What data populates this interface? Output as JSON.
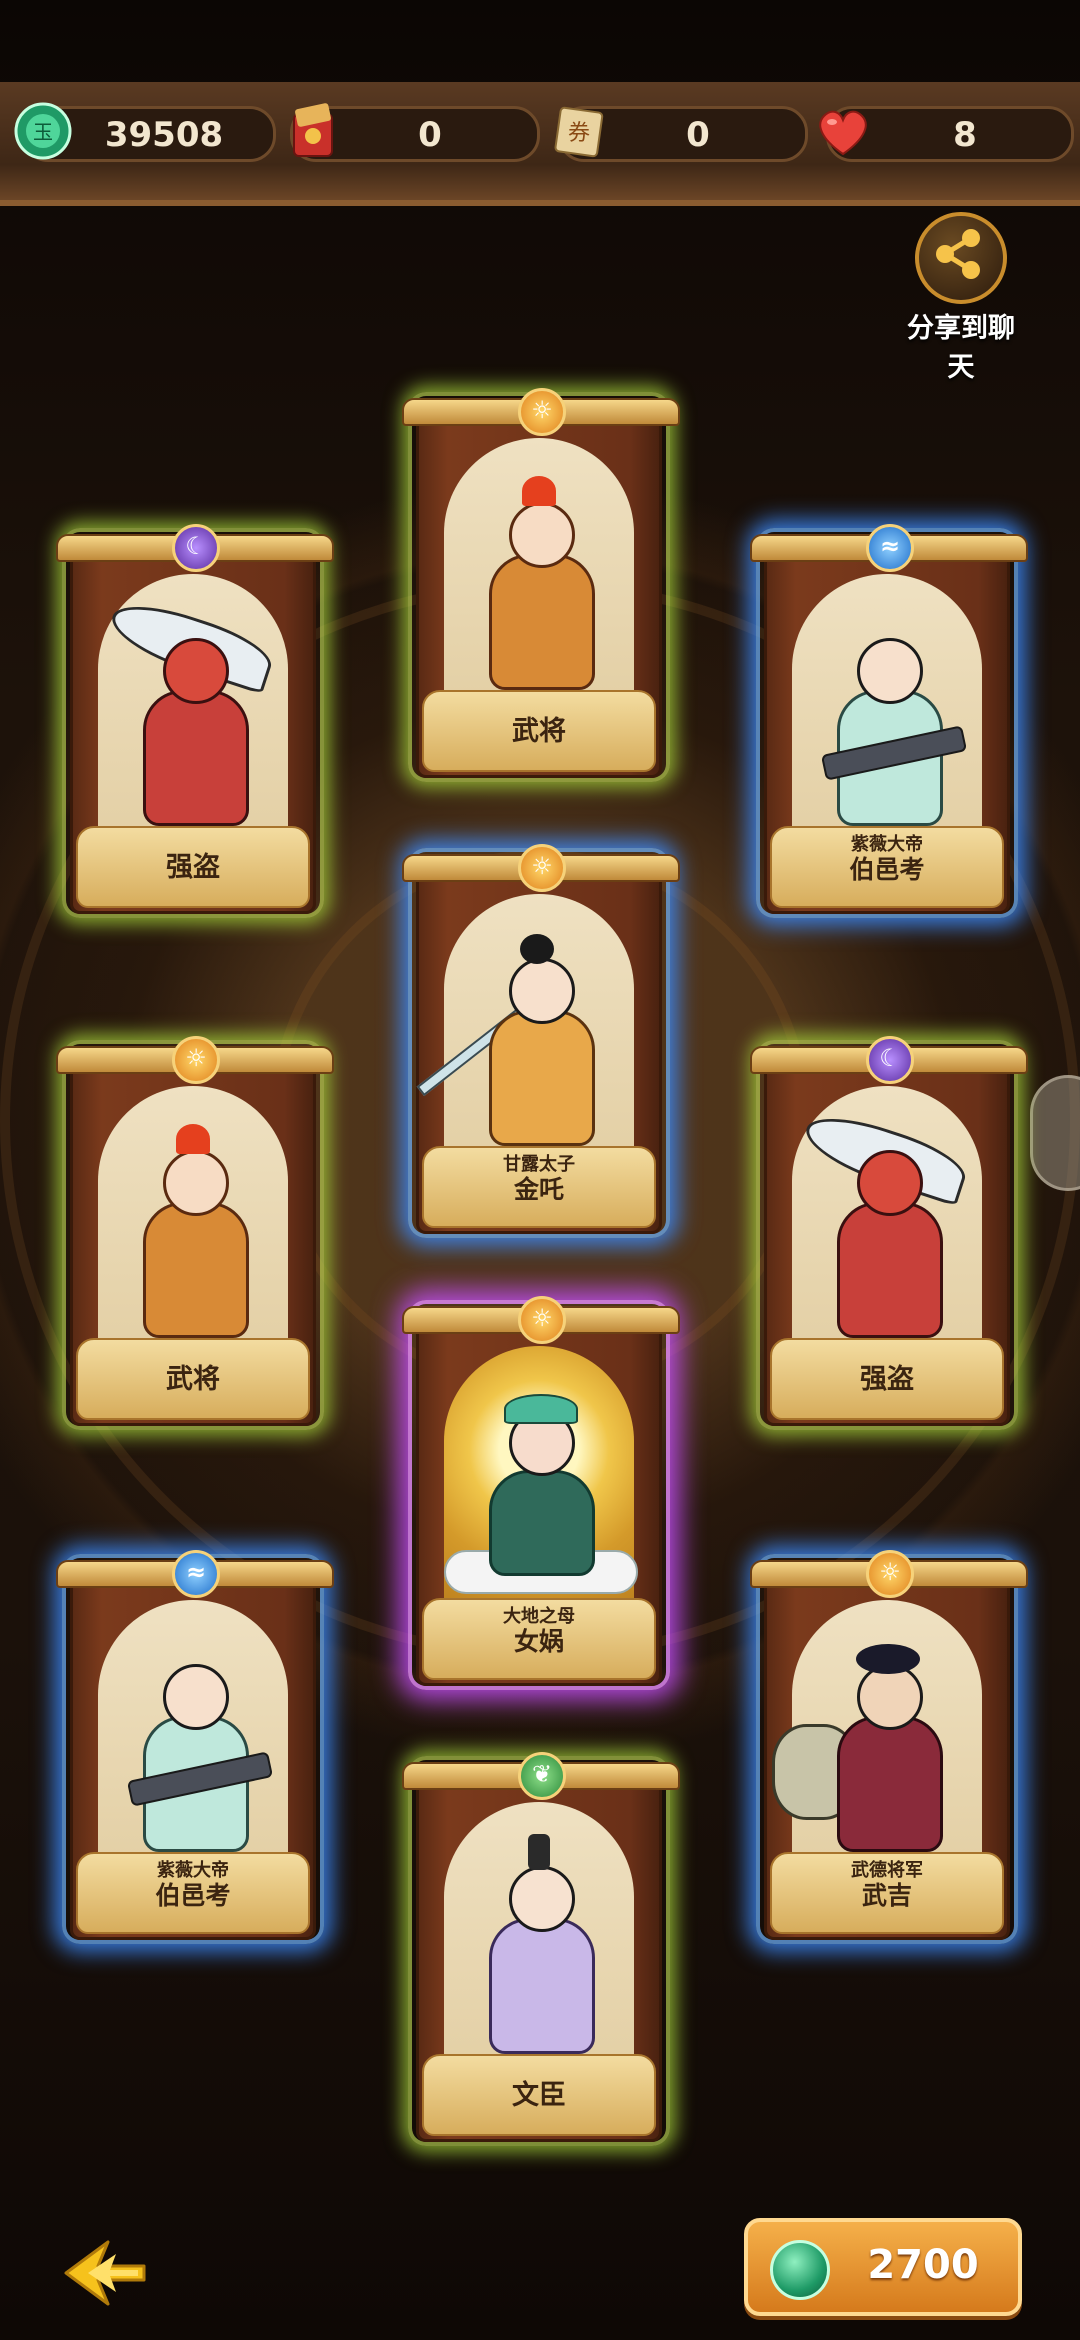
{
  "resources": [
    {
      "icon": "jade-coin-icon",
      "value": "39508"
    },
    {
      "icon": "red-envelope-icon",
      "value": "0"
    },
    {
      "icon": "ticket-icon",
      "value": "0"
    },
    {
      "icon": "heart-icon",
      "value": "8"
    }
  ],
  "share": {
    "label": "分享到聊天"
  },
  "cards": [
    {
      "id": "wujiang-top",
      "title": "",
      "name": "武将",
      "frame": "green",
      "element": "sun"
    },
    {
      "id": "qiangdao-left",
      "title": "",
      "name": "强盗",
      "frame": "green",
      "element": "moon"
    },
    {
      "id": "boyikao-right",
      "title": "紫薇大帝",
      "name": "伯邑考",
      "frame": "blue",
      "element": "water"
    },
    {
      "id": "nezha-center",
      "title": "甘露太子",
      "name": "金吒",
      "frame": "blue",
      "element": "sun"
    },
    {
      "id": "wujiang-left",
      "title": "",
      "name": "武将",
      "frame": "green",
      "element": "sun"
    },
    {
      "id": "qiangdao-right",
      "title": "",
      "name": "强盗",
      "frame": "green",
      "element": "moon"
    },
    {
      "id": "nvwa-center",
      "title": "大地之母",
      "name": "女娲",
      "frame": "purple",
      "element": "sun"
    },
    {
      "id": "boyikao-left",
      "title": "紫薇大帝",
      "name": "伯邑考",
      "frame": "blue",
      "element": "water"
    },
    {
      "id": "wuji-right",
      "title": "武德将军",
      "name": "武吉",
      "frame": "blue",
      "element": "sun"
    },
    {
      "id": "wenchen-bottom",
      "title": "",
      "name": "文臣",
      "frame": "green",
      "element": "leaf"
    }
  ],
  "cost": {
    "icon": "jade-coin-icon",
    "value": "2700"
  },
  "back": {
    "icon": "back-arrow-icon"
  }
}
